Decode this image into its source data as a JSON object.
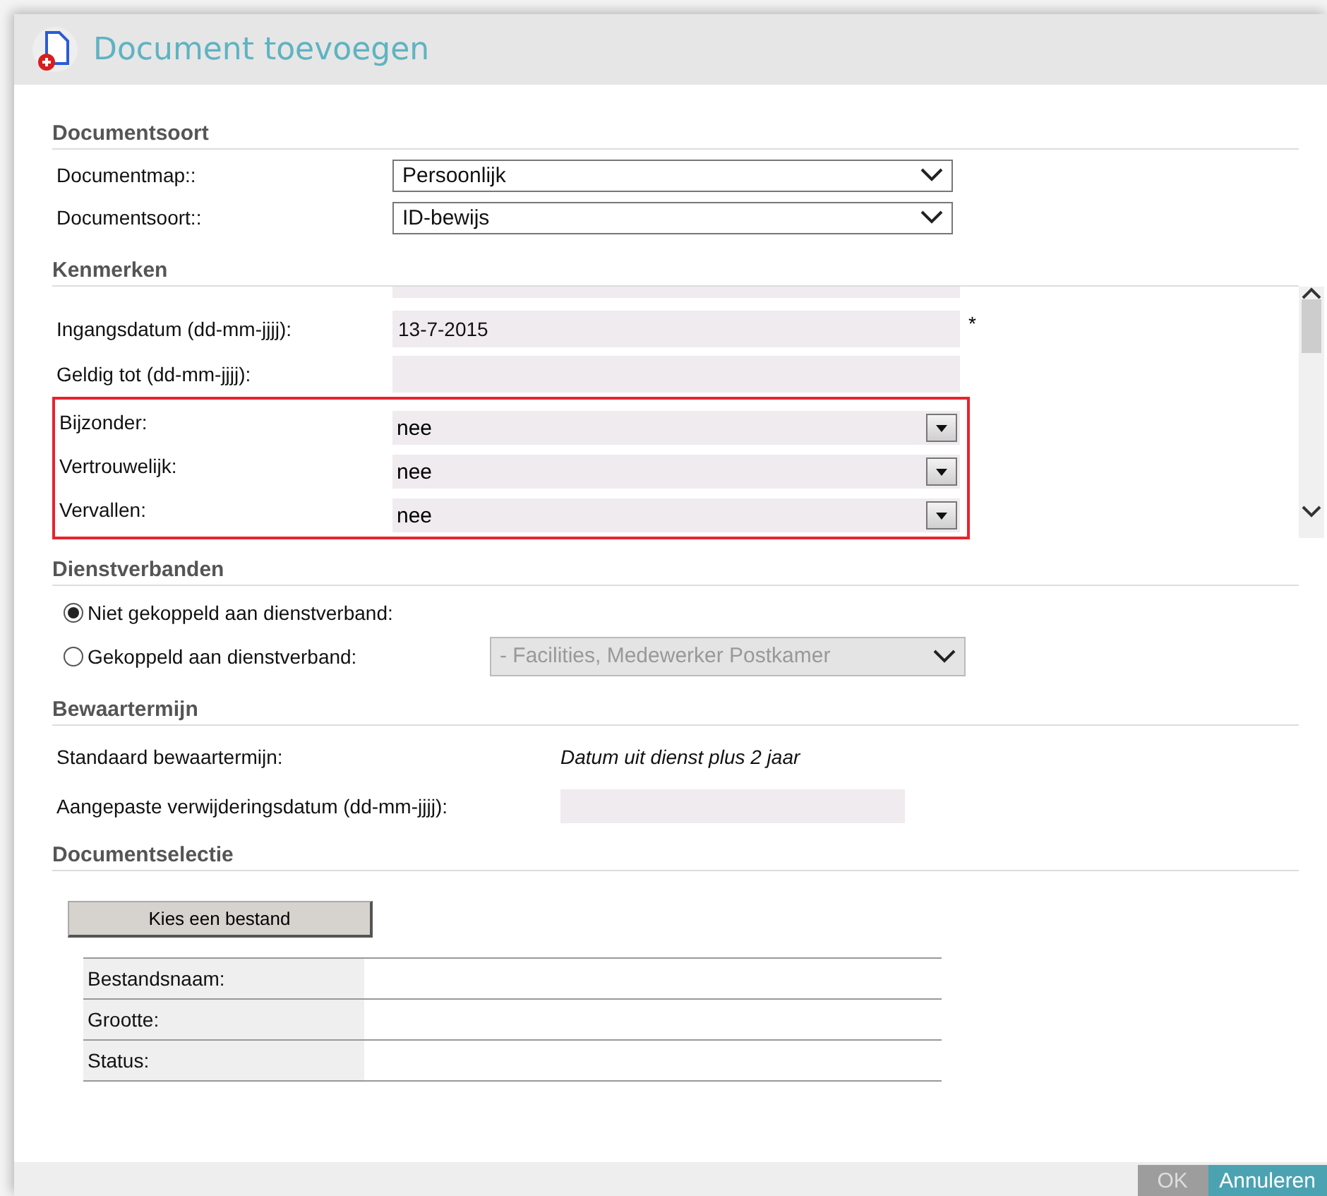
{
  "dialog": {
    "title": "Document toevoegen"
  },
  "documentsoort": {
    "heading": "Documentsoort",
    "fields": [
      {
        "label": "Documentmap::",
        "value": "Persoonlijk"
      },
      {
        "label": "Documentsoort::",
        "value": "ID-bewijs"
      }
    ]
  },
  "kenmerken": {
    "heading": "Kenmerken",
    "fields": [
      {
        "kind": "text",
        "label": "Ingangsdatum (dd-mm-jjjj):",
        "value": "13-7-2015",
        "required_mark": "*"
      },
      {
        "kind": "text",
        "label": "Geldig tot (dd-mm-jjjj):"
      }
    ],
    "highlighted_fields": [
      {
        "label": "Bijzonder:",
        "value": "nee"
      },
      {
        "label": "Vertrouwelijk:",
        "value": "nee"
      },
      {
        "label": "Vervallen:",
        "value": "nee"
      }
    ]
  },
  "dienstverbanden": {
    "heading": "Dienstverbanden",
    "options": [
      {
        "label": "Niet gekoppeld aan dienstverband:",
        "selected": true
      },
      {
        "label": "Gekoppeld aan dienstverband:",
        "selected": false,
        "select": {
          "value": "- Facilities, Medewerker Postkamer",
          "disabled": true
        }
      }
    ]
  },
  "bewaartermijn": {
    "heading": "Bewaartermijn",
    "standard_label": "Standaard bewaartermijn:",
    "standard_value": "Datum uit dienst plus 2 jaar",
    "custom_label": "Aangepaste verwijderingsdatum (dd-mm-jjjj):"
  },
  "documentselectie": {
    "heading": "Documentselectie",
    "button": "Kies een bestand",
    "rows": [
      {
        "label": "Bestandsnaam:"
      },
      {
        "label": "Grootte:"
      },
      {
        "label": "Status:"
      }
    ]
  },
  "footer": {
    "buttons": [
      {
        "label": "OK",
        "disabled": true
      },
      {
        "label": "Annuleren",
        "disabled": false
      }
    ]
  }
}
